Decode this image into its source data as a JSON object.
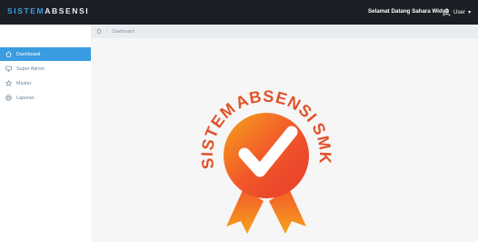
{
  "header": {
    "brand_accent": "SISTEM",
    "brand_rest": "ABSENSI",
    "welcome_text": "Selamat Datang Sahara Widya",
    "user_label": "User",
    "user_caret": "▾"
  },
  "sidebar": {
    "items": [
      {
        "label": "Dashboard",
        "icon": "home-icon",
        "active": true
      },
      {
        "label": "Super Admin",
        "icon": "monitor-icon",
        "active": false
      },
      {
        "label": "Master",
        "icon": "star-icon",
        "active": false
      },
      {
        "label": "Laporan",
        "icon": "printer-icon",
        "active": false
      }
    ]
  },
  "breadcrumb": {
    "separator": "/",
    "current": "Dashboard"
  },
  "logo": {
    "arc_left": "SISTEM",
    "arc_top": "ABSENSI",
    "arc_right": "SMK"
  },
  "colors": {
    "topbar": "#1b1e24",
    "accent": "#3a9de2",
    "badge_orange": "#f0582a",
    "badge_red": "#e93b2c",
    "badge_yellow": "#f7a21b"
  }
}
